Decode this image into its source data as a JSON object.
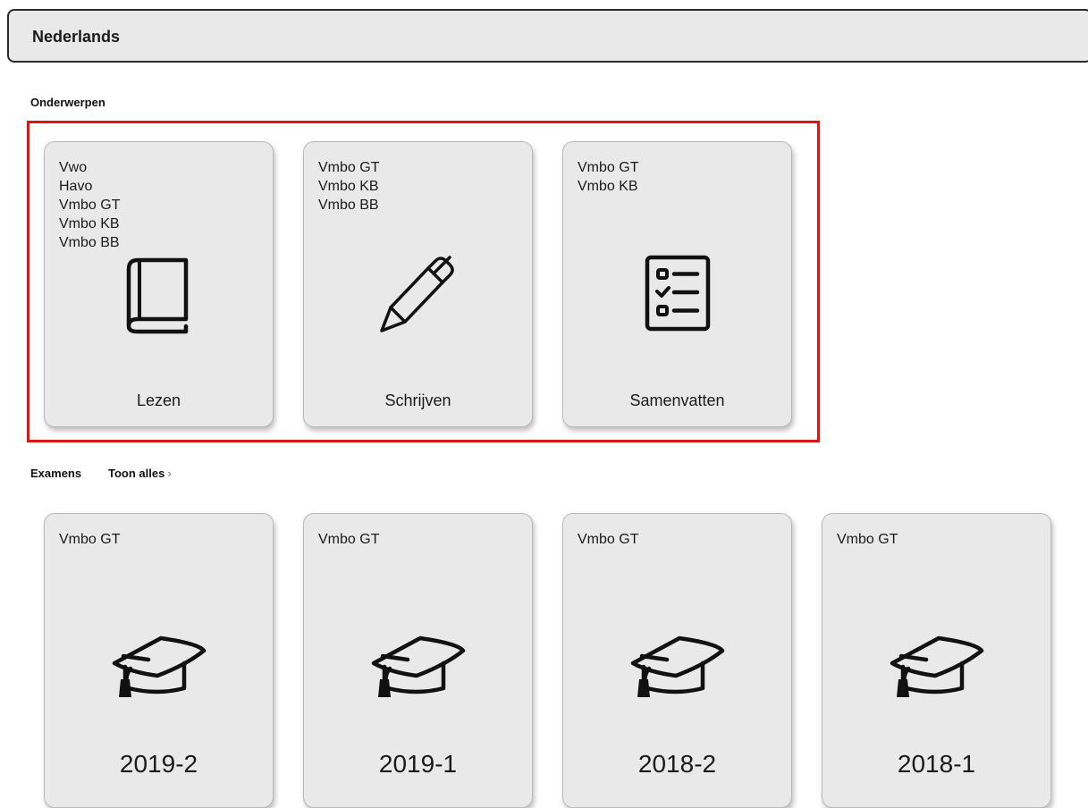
{
  "header": {
    "title": "Nederlands"
  },
  "subjects": {
    "label": "Onderwerpen",
    "items": [
      {
        "label": "Lezen",
        "icon": "book-icon",
        "levels": [
          "Vwo",
          "Havo",
          "Vmbo GT",
          "Vmbo KB",
          "Vmbo BB"
        ]
      },
      {
        "label": "Schrijven",
        "icon": "pen-icon",
        "levels": [
          "Vmbo GT",
          "Vmbo KB",
          "Vmbo BB"
        ]
      },
      {
        "label": "Samenvatten",
        "icon": "checklist-icon",
        "levels": [
          "Vmbo GT",
          "Vmbo KB"
        ]
      }
    ]
  },
  "exams": {
    "label": "Examens",
    "show_all": "Toon alles",
    "items": [
      {
        "label": "2019-2",
        "icon": "graduation-cap-icon",
        "levels": [
          "Vmbo GT"
        ]
      },
      {
        "label": "2019-1",
        "icon": "graduation-cap-icon",
        "levels": [
          "Vmbo GT"
        ]
      },
      {
        "label": "2018-2",
        "icon": "graduation-cap-icon",
        "levels": [
          "Vmbo GT"
        ]
      },
      {
        "label": "2018-1",
        "icon": "graduation-cap-icon",
        "levels": [
          "Vmbo GT"
        ]
      }
    ]
  },
  "colors": {
    "card_bg": "#e9e9e9",
    "highlight": "#e11414"
  }
}
